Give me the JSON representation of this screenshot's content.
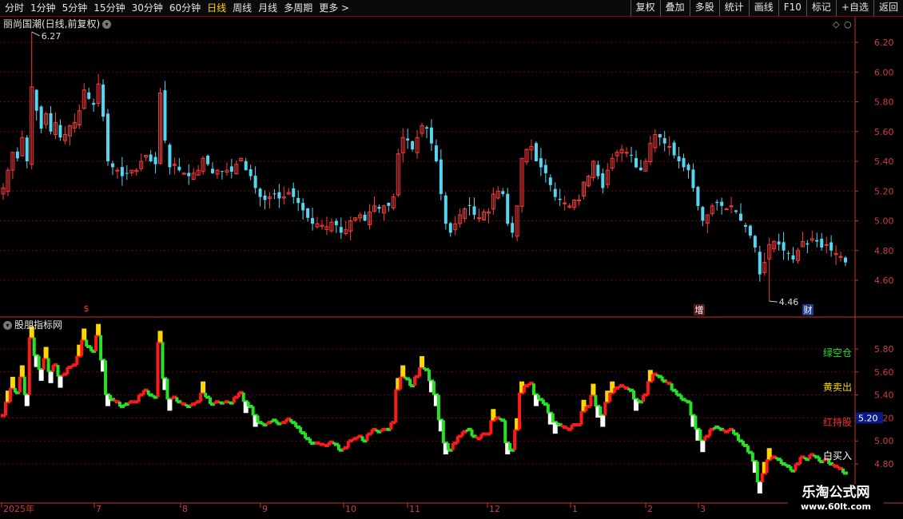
{
  "toolbar": {
    "period_tabs": [
      "分时",
      "1分钟",
      "5分钟",
      "15分钟",
      "30分钟",
      "60分钟",
      "日线",
      "周线",
      "月线",
      "多周期",
      "更多 >"
    ],
    "active_tab": "日线",
    "right_buttons": [
      "复权",
      "叠加",
      "多股",
      "统计",
      "画线",
      "F10",
      "标记",
      "+自选",
      "返回"
    ]
  },
  "stock_title": "丽尚国潮(日线,前复权)",
  "indicator_title": "股朋指标网",
  "price_panel": {
    "y_ticks": [
      "6.20",
      "6.00",
      "5.80",
      "5.60",
      "5.40",
      "5.20",
      "5.00",
      "4.80",
      "4.60"
    ],
    "high_label": "6.27",
    "low_label": "4.46",
    "markers": [
      "$",
      "增",
      "财"
    ]
  },
  "indicator_panel": {
    "y_ticks": [
      "5.80",
      "5.60",
      "5.40",
      "5.20",
      "5.00",
      "4.80"
    ],
    "current_value": "5.20",
    "legend": [
      {
        "text": "绿空仓",
        "color": "#2bd92b"
      },
      {
        "text": "黄卖出",
        "color": "#ffd700"
      },
      {
        "text": "红持股",
        "color": "#ff2a2a"
      },
      {
        "text": "白买入",
        "color": "#ffffff"
      }
    ]
  },
  "x_axis_labels": [
    "2025年",
    "7",
    "8",
    "9",
    "10",
    "11",
    "12",
    "1",
    "2",
    "3"
  ],
  "watermark": {
    "name": "乐淘公式网",
    "url": "www.60lt.com"
  },
  "colors": {
    "up": "#ff3a3a",
    "down": "#54d6f2",
    "grid": "#7a0000",
    "axis": "#c83232"
  },
  "chart_data": {
    "type": "candlestick",
    "y_range": [
      4.46,
      6.27
    ],
    "high": 6.27,
    "low": 4.46,
    "closes": [
      5.22,
      5.34,
      5.46,
      5.42,
      5.56,
      5.4,
      5.9,
      5.74,
      5.62,
      5.72,
      5.6,
      5.66,
      5.56,
      5.58,
      5.64,
      5.66,
      5.74,
      5.88,
      5.82,
      5.78,
      5.92,
      5.7,
      5.4,
      5.36,
      5.34,
      5.3,
      5.32,
      5.34,
      5.34,
      5.4,
      5.44,
      5.4,
      5.38,
      5.86,
      5.54,
      5.36,
      5.38,
      5.34,
      5.32,
      5.3,
      5.32,
      5.34,
      5.42,
      5.38,
      5.32,
      5.34,
      5.33,
      5.34,
      5.33,
      5.38,
      5.42,
      5.34,
      5.3,
      5.22,
      5.16,
      5.14,
      5.16,
      5.18,
      5.15,
      5.16,
      5.19,
      5.16,
      5.12,
      5.07,
      5.02,
      4.98,
      4.98,
      4.97,
      4.96,
      4.99,
      4.97,
      4.92,
      4.94,
      5.0,
      5.02,
      5.04,
      5.0,
      5.06,
      5.1,
      5.08,
      5.1,
      5.1,
      5.16,
      5.45,
      5.56,
      5.54,
      5.48,
      5.56,
      5.64,
      5.62,
      5.52,
      5.4,
      5.18,
      4.98,
      4.92,
      4.98,
      5.04,
      5.08,
      5.1,
      5.04,
      5.02,
      5.06,
      5.06,
      5.18,
      5.2,
      5.18,
      4.98,
      4.92,
      5.1,
      5.42,
      5.48,
      5.5,
      5.4,
      5.36,
      5.32,
      5.24,
      5.16,
      5.14,
      5.12,
      5.1,
      5.14,
      5.14,
      5.26,
      5.3,
      5.4,
      5.3,
      5.22,
      5.34,
      5.42,
      5.46,
      5.48,
      5.46,
      5.44,
      5.36,
      5.34,
      5.4,
      5.52,
      5.58,
      5.56,
      5.52,
      5.5,
      5.44,
      5.4,
      5.36,
      5.34,
      5.22,
      5.1,
      5.0,
      5.04,
      5.1,
      5.12,
      5.1,
      5.08,
      5.1,
      5.06,
      5.0,
      4.96,
      4.9,
      4.82,
      4.64,
      4.72,
      4.84,
      4.86,
      4.84,
      4.8,
      4.78,
      4.74,
      4.8,
      4.86,
      4.84,
      4.88,
      4.86,
      4.82,
      4.84,
      4.8,
      4.78,
      4.76,
      4.72
    ]
  }
}
